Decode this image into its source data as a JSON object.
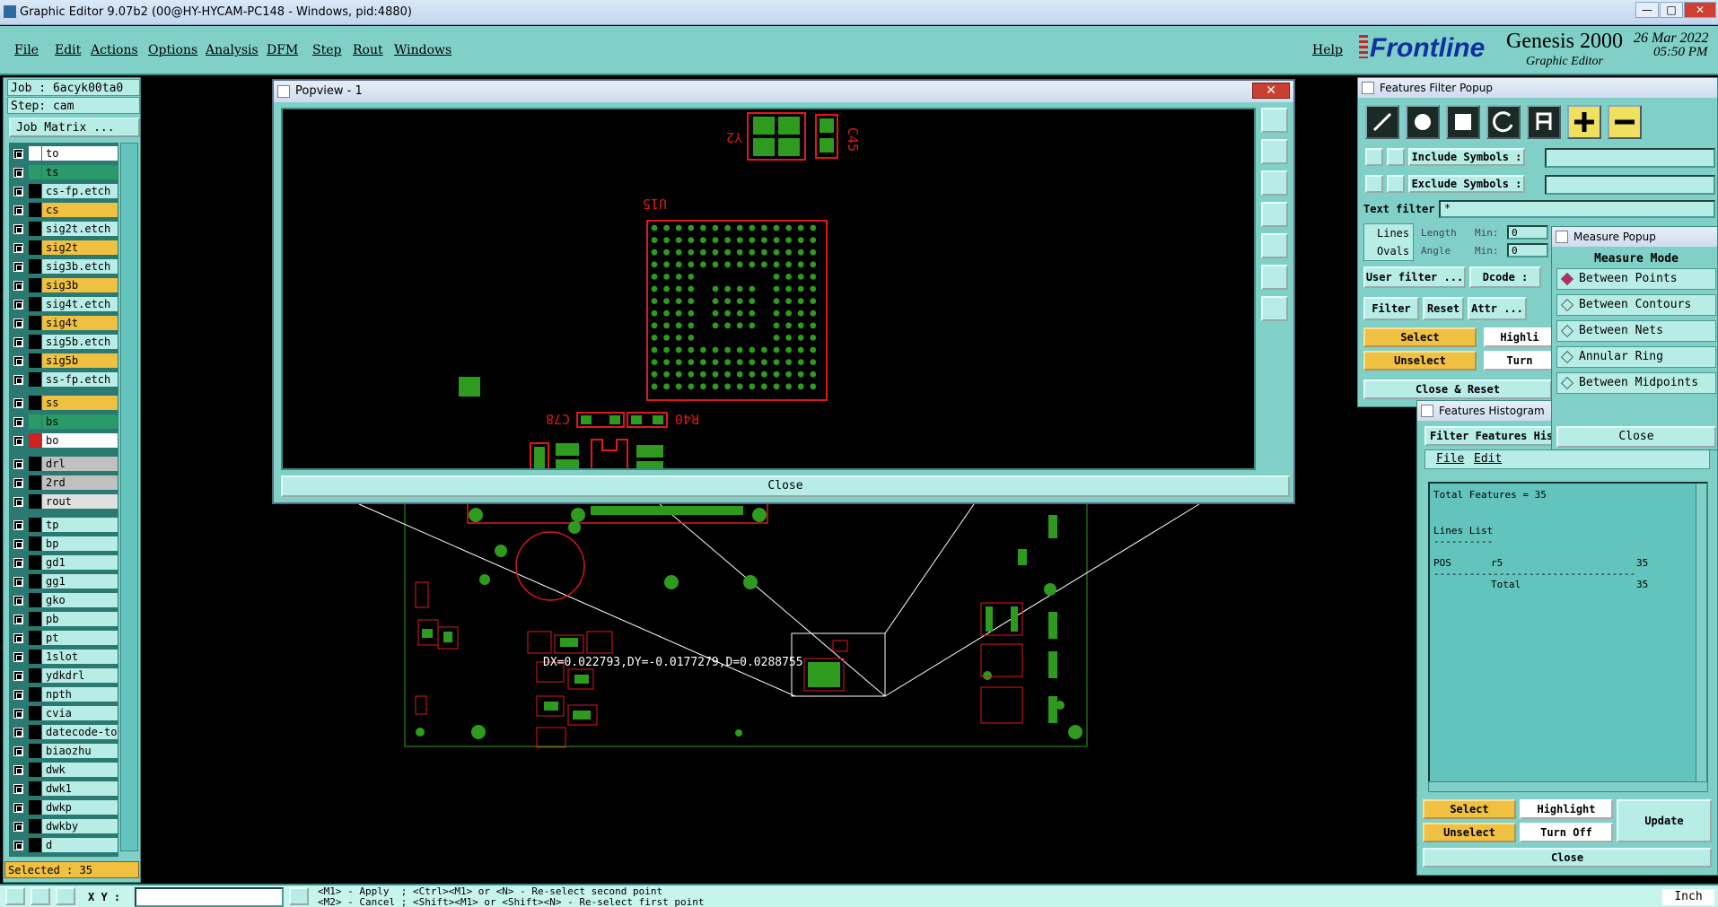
{
  "window": {
    "title": "Graphic Editor 9.07b2 (00@HY-HYCAM-PC148 - Windows, pid:4880)",
    "minimize": "—",
    "maximize": "□",
    "close": "✕"
  },
  "menu": {
    "items": [
      "File",
      "Edit",
      "Actions",
      "Options",
      "Analysis",
      "DFM",
      "Step",
      "Rout",
      "Windows"
    ],
    "help": "Help"
  },
  "brand": {
    "logo": "Frontline",
    "product": "Genesis 2000",
    "subtitle": "Graphic Editor",
    "date": "26 Mar 2022",
    "time": "05:50 PM"
  },
  "job": {
    "job_line": "Job : 6acyk00ta0",
    "step_line": "Step: cam",
    "matrix_button": "Job Matrix ..."
  },
  "layers": [
    {
      "name": "to",
      "color": "#ffffff",
      "mark": "#ffffff"
    },
    {
      "name": "ts",
      "color": "#2a9a6a",
      "mark": "#2a9a6a"
    },
    {
      "name": "cs-fp.etch",
      "color": "#b8ece6",
      "mark": "#000000"
    },
    {
      "name": "cs",
      "color": "#f0c040",
      "mark": "#000000"
    },
    {
      "name": "sig2t.etch",
      "color": "#b8ece6",
      "mark": "#000000"
    },
    {
      "name": "sig2t",
      "color": "#f0c040",
      "mark": "#000000"
    },
    {
      "name": "sig3b.etch",
      "color": "#b8ece6",
      "mark": "#000000"
    },
    {
      "name": "sig3b",
      "color": "#f0c040",
      "mark": "#000000"
    },
    {
      "name": "sig4t.etch",
      "color": "#b8ece6",
      "mark": "#000000"
    },
    {
      "name": "sig4t",
      "color": "#f0c040",
      "mark": "#000000"
    },
    {
      "name": "sig5b.etch",
      "color": "#b8ece6",
      "mark": "#000000"
    },
    {
      "name": "sig5b",
      "color": "#f0c040",
      "mark": "#000000"
    },
    {
      "name": "ss-fp.etch",
      "color": "#b8ece6",
      "mark": "#000000"
    },
    {
      "name": "ss",
      "color": "#f0c040",
      "mark": "#000000"
    },
    {
      "name": "bs",
      "color": "#2a9a6a",
      "mark": "#2a9a6a"
    },
    {
      "name": "bo",
      "color": "#ffffff",
      "mark": "#d02020"
    },
    {
      "name": "drl",
      "color": "#c0c0c0",
      "mark": "#000000"
    },
    {
      "name": "2rd",
      "color": "#c0c0c0",
      "mark": "#000000"
    },
    {
      "name": "rout",
      "color": "#e0e0e0",
      "mark": "#000000"
    },
    {
      "name": "tp",
      "color": "#b8ece6",
      "mark": "#000000"
    },
    {
      "name": "bp",
      "color": "#b8ece6",
      "mark": "#000000"
    },
    {
      "name": "gd1",
      "color": "#b8ece6",
      "mark": "#000000"
    },
    {
      "name": "gg1",
      "color": "#b8ece6",
      "mark": "#000000"
    },
    {
      "name": "gko",
      "color": "#b8ece6",
      "mark": "#000000"
    },
    {
      "name": "pb",
      "color": "#b8ece6",
      "mark": "#000000"
    },
    {
      "name": "pt",
      "color": "#b8ece6",
      "mark": "#000000"
    },
    {
      "name": "1slot",
      "color": "#b8ece6",
      "mark": "#000000"
    },
    {
      "name": "ydkdrl",
      "color": "#b8ece6",
      "mark": "#000000"
    },
    {
      "name": "npth",
      "color": "#b8ece6",
      "mark": "#000000"
    },
    {
      "name": "cvia",
      "color": "#b8ece6",
      "mark": "#000000"
    },
    {
      "name": "datecode-to",
      "color": "#b8ece6",
      "mark": "#000000"
    },
    {
      "name": "biaozhu",
      "color": "#b8ece6",
      "mark": "#000000"
    },
    {
      "name": "dwk",
      "color": "#b8ece6",
      "mark": "#000000"
    },
    {
      "name": "dwk1",
      "color": "#b8ece6",
      "mark": "#000000"
    },
    {
      "name": "dwkp",
      "color": "#b8ece6",
      "mark": "#000000"
    },
    {
      "name": "dwkby",
      "color": "#b8ece6",
      "mark": "#000000"
    },
    {
      "name": "d",
      "color": "#b8ece6",
      "mark": "#000000"
    }
  ],
  "selected_text": "Selected : 35",
  "status": {
    "xy_label": "X Y :",
    "hint1": "<M1> - Apply  ; <Ctrl><M1> or <N> - Re-select second point",
    "hint2": "<M2> - Cancel ; <Shift><M1> or <Shift><N> - Re-select first point",
    "units": "Inch"
  },
  "popview": {
    "title": "Popview - 1",
    "close": "Close",
    "labels": {
      "u15": "U15",
      "y2": "Y2",
      "c45": "C45",
      "c78": "C78",
      "r40": "R40"
    }
  },
  "canvas": {
    "measure_text": "DX=0.022793,DY=-0.0177279,D=0.0288755"
  },
  "filter_popup": {
    "title": "Features Filter Popup",
    "include": "Include Symbols :",
    "exclude": "Exclude Symbols :",
    "text_filter": "Text filter",
    "text_filter_value": "*",
    "lines": "Lines",
    "ovals": "Ovals",
    "length": "Length",
    "angle": "Angle",
    "min": "Min:",
    "min_val": "0",
    "user_filter": "User filter ...",
    "dcode": "Dcode :",
    "filter": "Filter",
    "reset": "Reset",
    "attr": "Attr ...",
    "select": "Select",
    "highlight": "Highli",
    "unselect": "Unselect",
    "turn": "Turn",
    "close_reset": "Close & Reset"
  },
  "measure_popup": {
    "title": "Measure Popup",
    "mode_label": "Measure Mode",
    "options": [
      "Between Points",
      "Between Contours",
      "Between Nets",
      "Annular Ring",
      "Between Midpoints"
    ],
    "selected": "Between Points",
    "close": "Close"
  },
  "histogram": {
    "title": "Features Histogram",
    "filter_label": "Filter Features His",
    "menu": [
      "File",
      "Edit"
    ],
    "total_features": "Total Features = 35",
    "list_title": "Lines List",
    "list_underline": "----------",
    "row_type": "POS",
    "row_symbol": "r5",
    "row_count": "35",
    "separator": "----------------------------------",
    "total_label": "Total",
    "total_count": "35",
    "select": "Select",
    "highlight": "Highlight",
    "update": "Update",
    "unselect": "Unselect",
    "turn_off": "Turn Off",
    "close": "Close"
  },
  "colors": {
    "panel": "#80d0c8",
    "field": "#b8ece6",
    "yellow": "#f0c040",
    "copper": "#2e9a1e",
    "silk": "#e01818"
  }
}
